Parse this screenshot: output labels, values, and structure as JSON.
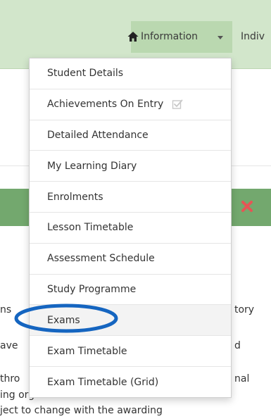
{
  "navbar": {
    "home_icon": "home-icon",
    "info_label": "Information",
    "info_caret_icon": "caret-down-icon",
    "next_item_label": "Indiv"
  },
  "background": {
    "text_lines": [
      {
        "left": "ns",
        "right": "tory"
      },
      {
        "left": "ave",
        "right": "d"
      },
      {
        "left": "thro",
        "right": "nal"
      },
      {
        "full": "ing organisations."
      },
      {
        "full": "ject to change with the awarding"
      }
    ],
    "close_icon": "close-icon"
  },
  "dropdown": {
    "items": [
      {
        "label": "Student Details"
      },
      {
        "label": "Achievements On Entry",
        "icon": "checkbox-icon"
      },
      {
        "label": "Detailed Attendance"
      },
      {
        "label": "My Learning Diary"
      },
      {
        "label": "Enrolments"
      },
      {
        "label": "Lesson Timetable"
      },
      {
        "label": "Assessment Schedule"
      },
      {
        "label": "Study Programme"
      },
      {
        "label": "Exams"
      },
      {
        "label": "Exam Timetable"
      },
      {
        "label": "Exam Timetable (Grid)"
      }
    ],
    "highlighted_item": "Exams"
  },
  "colors": {
    "navbar_bg": "#d2e6cb",
    "nav_active_bg": "#bad8b0",
    "alert_bg": "#73a86e",
    "close_icon": "#e65555",
    "annotation": "#1565c0"
  }
}
